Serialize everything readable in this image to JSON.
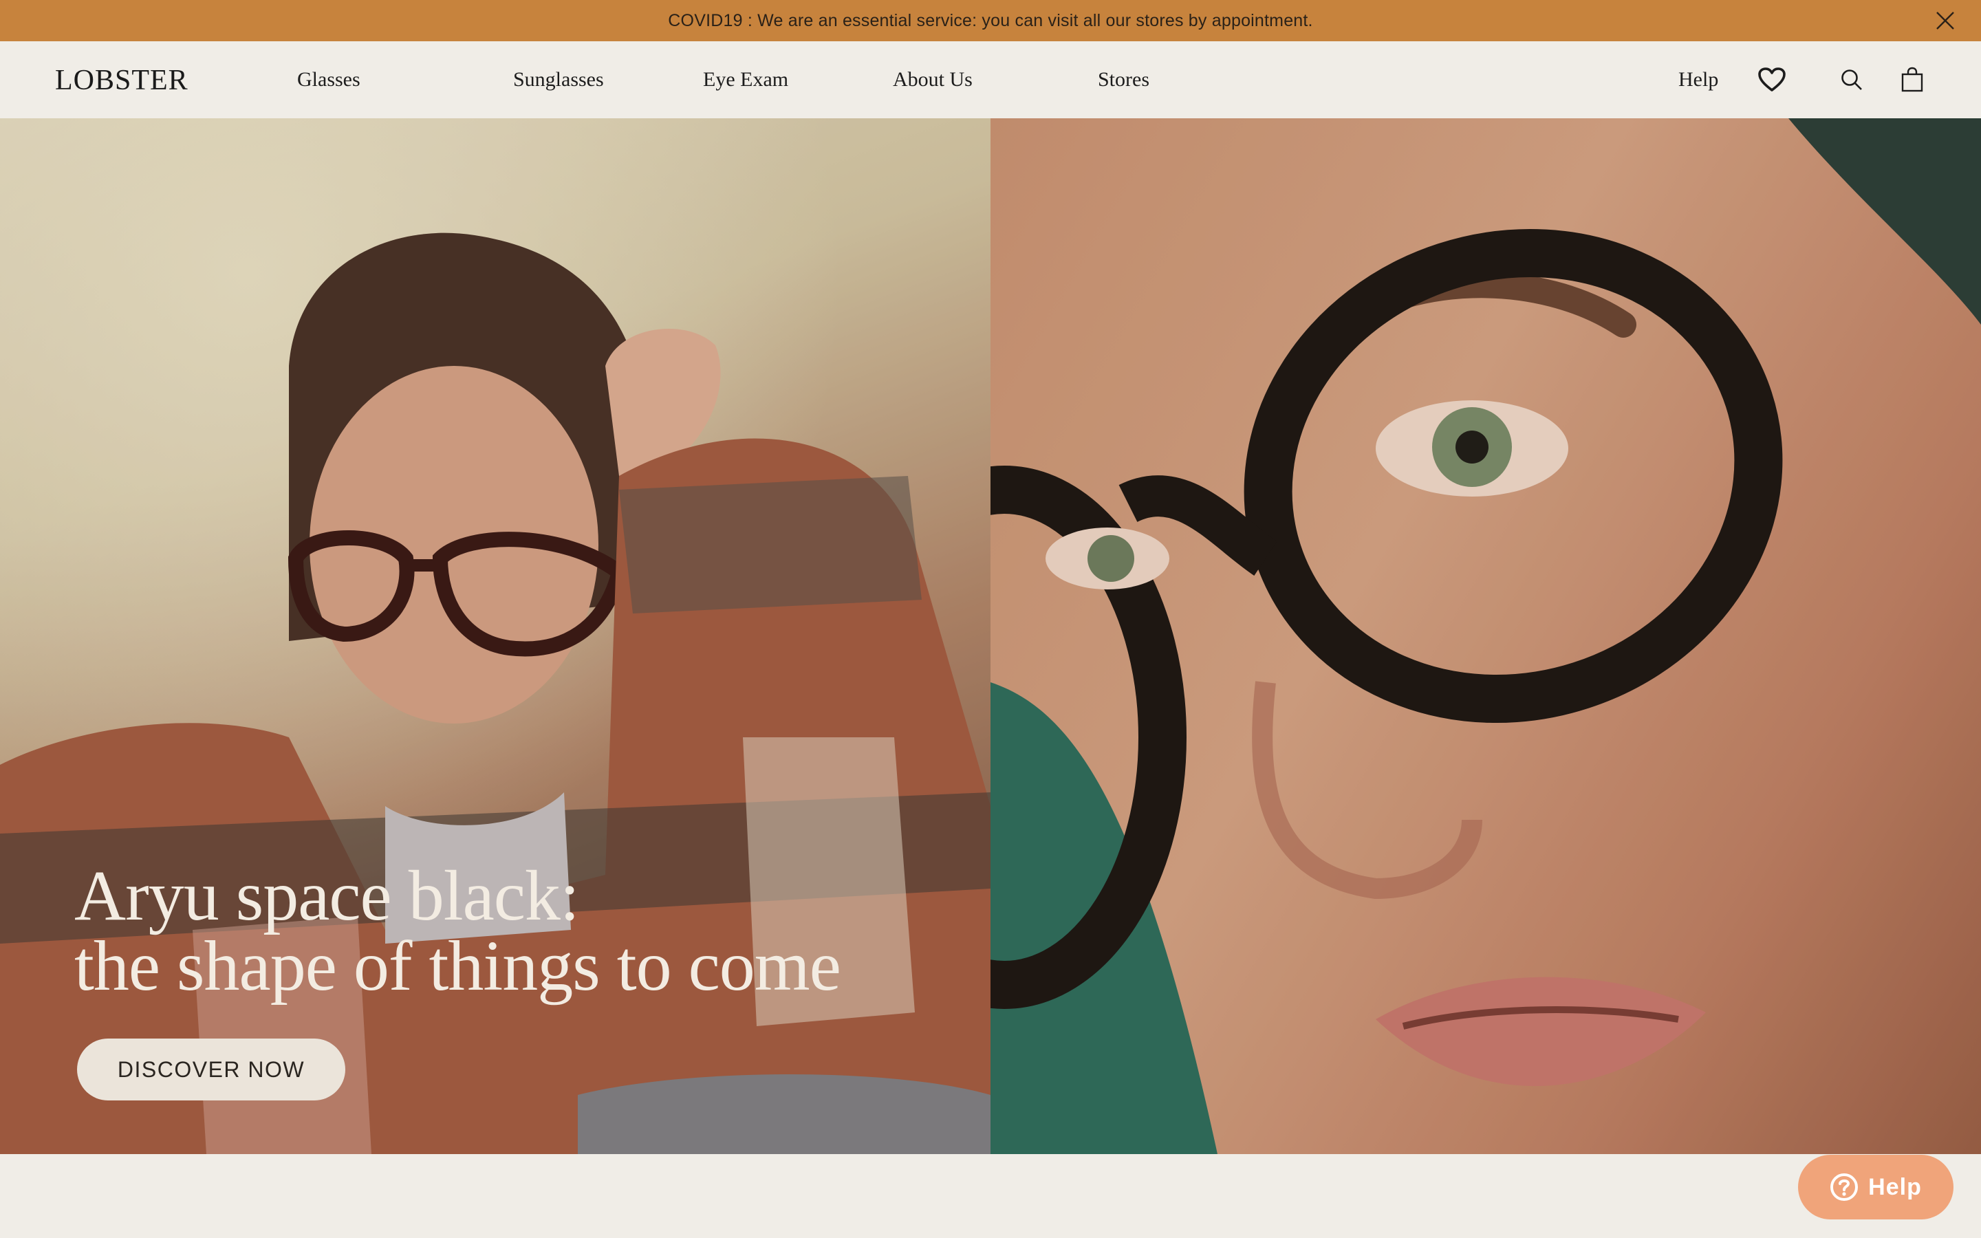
{
  "announcement": {
    "text": "COVID19 : We are an essential service: you can visit all our stores by appointment.",
    "close_icon": "close-icon"
  },
  "header": {
    "logo": "LOBSTER",
    "nav": [
      "Glasses",
      "Sunglasses",
      "Eye Exam",
      "About Us",
      "Stores"
    ],
    "help": "Help",
    "icons": [
      "heart-icon",
      "search-icon",
      "bag-icon"
    ]
  },
  "hero": {
    "headline_line1": "Aryu space black:",
    "headline_line2": "the shape of things to come",
    "cta_label": "DISCOVER NOW"
  },
  "help_widget": {
    "label": "Help",
    "icon": "question-circle-icon"
  },
  "colors": {
    "announcement_bg": "#c7833d",
    "page_bg": "#f0ede7",
    "help_widget_bg": "#f0a47a"
  }
}
